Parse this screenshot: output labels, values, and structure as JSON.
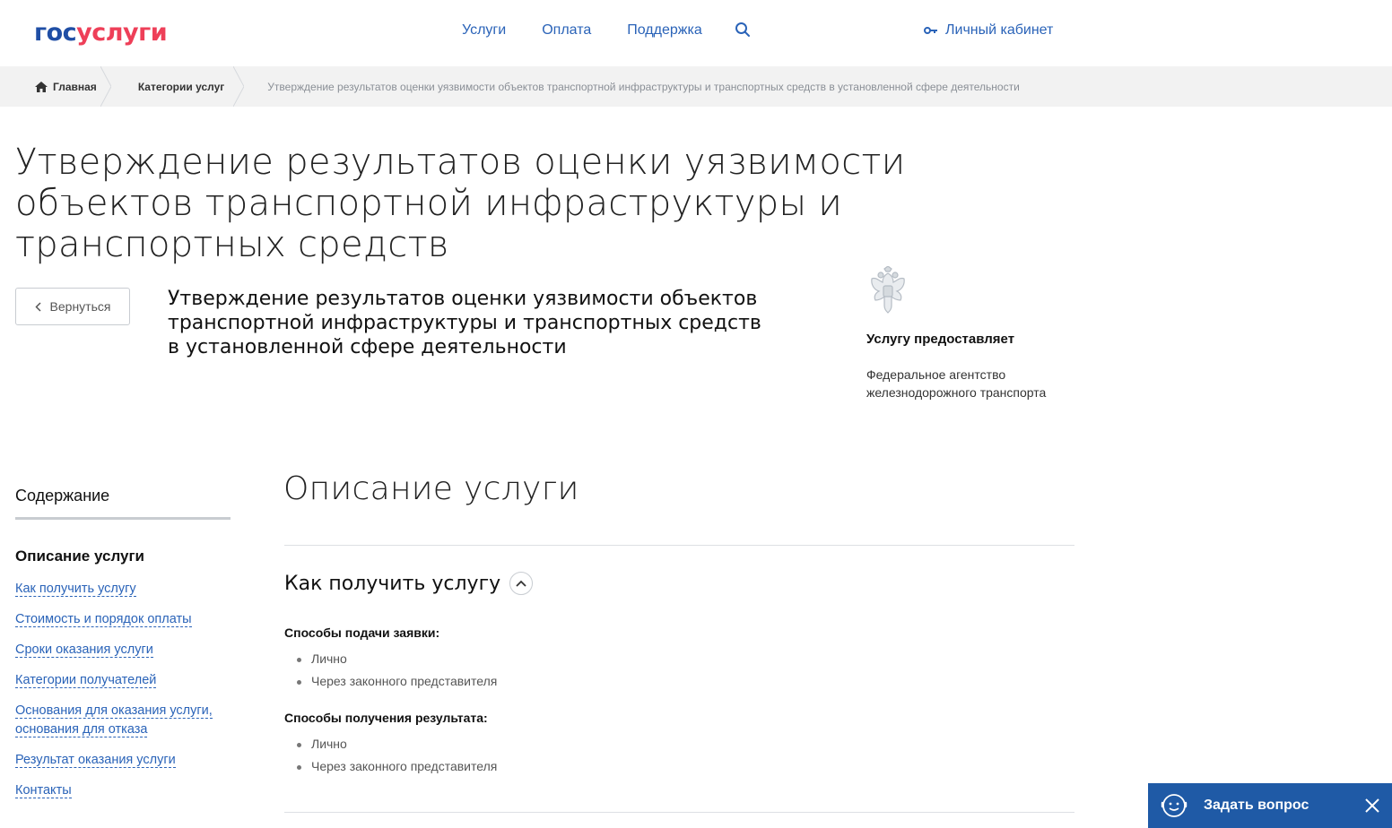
{
  "header": {
    "logo_part1": "гос",
    "logo_part2": "услуги",
    "nav": [
      "Услуги",
      "Оплата",
      "Поддержка"
    ],
    "cabinet": "Личный кабинет"
  },
  "breadcrumbs": {
    "home": "Главная",
    "category": "Категории услуг",
    "current": "Утверждение результатов оценки уязвимости объектов транспортной инфраструктуры и транспортных средств в установленной сфере деятельности"
  },
  "page_title": "Утверждение результатов оценки уязвимости объектов транспортной инфраструктуры и транспортных средств",
  "back_label": "Вернуться",
  "service_name": "Утверждение результатов оценки уязвимости объектов транспортной инфраструктуры и транспортных средств в установленной сфере деятельности",
  "provider": {
    "title": "Услугу предоставляет",
    "name": "Федеральное агентство железнодорожного транспорта"
  },
  "sidebar": {
    "title": "Содержание",
    "current": "Описание услуги",
    "items": [
      "Как получить услугу",
      "Стоимость и порядок оплаты",
      "Сроки оказания услуги",
      "Категории получателей",
      "Основания для оказания услуги, основания для отказа",
      "Результат оказания услуги",
      "Контакты"
    ]
  },
  "main": {
    "section_title": "Описание услуги",
    "subsection_title": "Как получить услугу",
    "groups": [
      {
        "heading": "Способы подачи заявки:",
        "items": [
          "Лично",
          "Через законного представителя"
        ]
      },
      {
        "heading": "Способы получения результата:",
        "items": [
          "Лично",
          "Через законного представителя"
        ]
      }
    ]
  },
  "ask_widget": {
    "label": "Задать вопрос"
  },
  "colors": {
    "link": "#2a63b8",
    "logo_blue": "#1f4ea5",
    "logo_red": "#ee3f58",
    "widget": "#1f5aa6"
  }
}
